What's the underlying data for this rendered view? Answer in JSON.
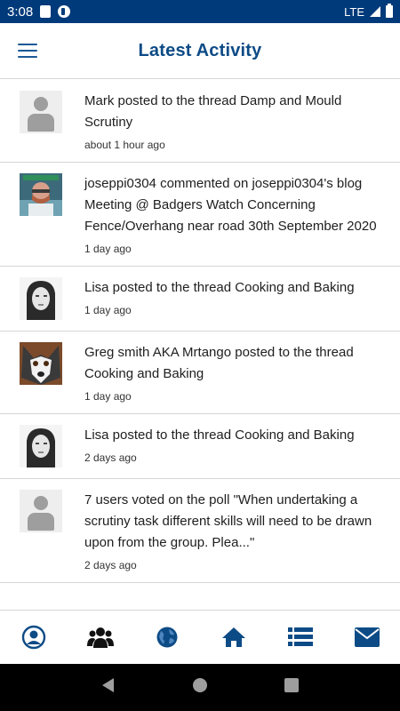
{
  "status_bar": {
    "time": "3:08",
    "network": "LTE"
  },
  "header": {
    "title": "Latest Activity"
  },
  "feed": [
    {
      "text": "Mark posted to the thread Damp and Mould Scrutiny",
      "time": "about 1 hour ago"
    },
    {
      "text": "joseppi0304 commented on joseppi0304's blog Meeting @ Badgers Watch Concerning Fence/Overhang near road 30th September 2020",
      "time": "1 day ago"
    },
    {
      "text": "Lisa posted to the thread Cooking and Baking",
      "time": "1 day ago"
    },
    {
      "text": "Greg smith AKA Mrtango posted to the thread Cooking and Baking",
      "time": "1 day ago"
    },
    {
      "text": "Lisa posted to the thread Cooking and Baking",
      "time": "2 days ago"
    },
    {
      "text": "7 users voted on the poll \"When undertaking a scrutiny task different skills will need to be drawn upon from the group. Plea...\"",
      "time": "2 days ago"
    }
  ],
  "bottom_nav": {
    "icons": [
      "profile-icon",
      "groups-icon",
      "globe-icon",
      "home-icon",
      "list-icon",
      "mail-icon"
    ],
    "accent": "#0d4b86"
  },
  "colors": {
    "status_bar": "#003a7a",
    "title": "#0d4b86",
    "divider": "#d6d6d6"
  }
}
